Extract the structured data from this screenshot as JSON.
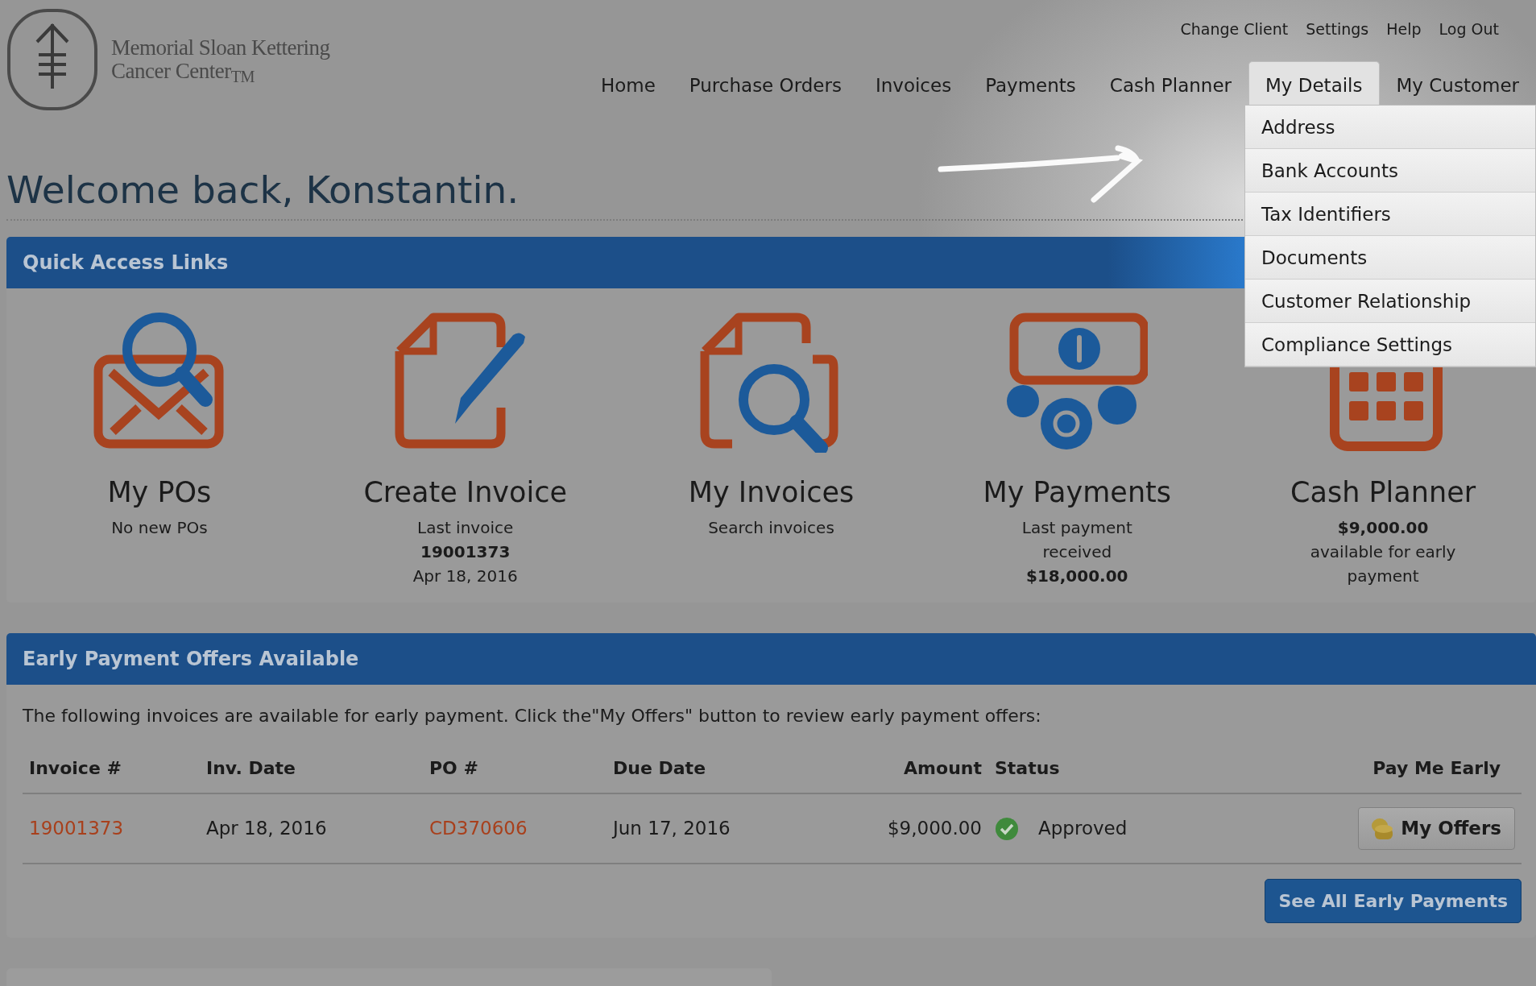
{
  "logo": {
    "lines": [
      "Memorial Sloan Kettering",
      "Cancer Center$_{TM}$"
    ]
  },
  "top_links": [
    "Change Client",
    "Settings",
    "Help",
    "Log Out"
  ],
  "nav": [
    {
      "label": "Home",
      "selected": false
    },
    {
      "label": "Purchase Orders",
      "selected": false
    },
    {
      "label": "Invoices",
      "selected": false
    },
    {
      "label": "Payments",
      "selected": false
    },
    {
      "label": "Cash Planner",
      "selected": false
    },
    {
      "label": "My Details",
      "selected": true
    },
    {
      "label": "My Customer",
      "selected": false
    }
  ],
  "dropdown": [
    "Address",
    "Bank Accounts",
    "Tax Identifiers",
    "Documents",
    "Customer Relationship",
    "Compliance Settings"
  ],
  "welcome": "Welcome back, Konstantin.",
  "quick_access": {
    "title": "Quick Access Links",
    "links": [
      {
        "kind": "envelope",
        "title": "My POs",
        "lines": [
          {
            "text": "No new POs",
            "bold": false
          }
        ]
      },
      {
        "kind": "edit",
        "title": "Create Invoice",
        "lines": [
          {
            "text": "Last invoice",
            "bold": false
          },
          {
            "text": "19001373",
            "bold": true
          },
          {
            "text": "Apr 18, 2016",
            "bold": false
          }
        ]
      },
      {
        "kind": "search",
        "title": "My Invoices",
        "lines": [
          {
            "text": "Search invoices",
            "bold": false
          }
        ]
      },
      {
        "kind": "money",
        "title": "My Payments",
        "lines": [
          {
            "text": "Last payment",
            "bold": false
          },
          {
            "text": "received",
            "bold": false
          },
          {
            "text": "$18,000.00",
            "bold": true
          }
        ]
      },
      {
        "kind": "calculator",
        "title": "Cash Planner",
        "lines": [
          {
            "text": "$9,000.00",
            "bold": true
          },
          {
            "text": "available for early",
            "bold": false
          },
          {
            "text": "payment",
            "bold": false
          }
        ]
      }
    ]
  },
  "early_payments": {
    "title": "Early Payment Offers Available",
    "intro": "The following invoices are available for early payment. Click the\"My Offers\" button to review early payment offers:",
    "columns": [
      "Invoice #",
      "Inv. Date",
      "PO #",
      "Due Date",
      "Amount",
      "Status",
      "Pay Me Early"
    ],
    "rows": [
      {
        "invoice": "19001373",
        "inv_date": "Apr 18, 2016",
        "po": "CD370606",
        "due_date": "Jun 17, 2016",
        "amount": "$9,000.00",
        "status": "Approved",
        "action": "My Offers"
      }
    ],
    "button": "See All Early Payments"
  }
}
